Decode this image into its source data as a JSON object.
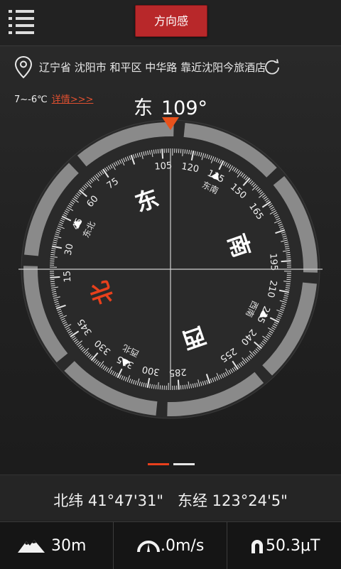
{
  "app": {
    "title_button": "方向感"
  },
  "location": {
    "address": "辽宁省 沈阳市 和平区 中华路 靠近沈阳今旅酒店"
  },
  "weather": {
    "temperature": "7~-6℃",
    "detail_link": "详情>>>"
  },
  "heading": {
    "direction": "东",
    "degrees": "109°",
    "value": 109
  },
  "compass": {
    "cardinals": {
      "north": "北",
      "east": "东",
      "south": "南",
      "west": "西"
    },
    "intercardinals": {
      "northeast": "东北",
      "southeast": "东南",
      "southwest": "西南",
      "northwest": "西北"
    },
    "degree_labels": [
      "15",
      "30",
      "45",
      "60",
      "75",
      "105",
      "120",
      "135",
      "150",
      "165",
      "195",
      "210",
      "225",
      "240",
      "255",
      "285",
      "300",
      "315",
      "330",
      "345"
    ],
    "colors": {
      "north_accent": "#e8401c",
      "pointer": "#e8521c",
      "ring": "#8a8a8a"
    }
  },
  "pager": {
    "pages": 2,
    "active_index": 0,
    "active_color": "#e8401c",
    "inactive_color": "#e6e6e6"
  },
  "coordinates": {
    "latitude": "北纬 41°47'31\"",
    "longitude": "东经 123°24'5\""
  },
  "stats": {
    "altitude": "30m",
    "speed": ".0m/s",
    "magnetic": "50.3μT"
  },
  "icons": [
    "menu-icon",
    "location-pin-icon",
    "refresh-icon",
    "mountain-icon",
    "speedometer-icon",
    "magnet-icon"
  ]
}
